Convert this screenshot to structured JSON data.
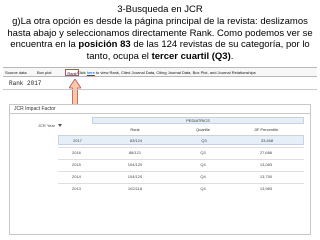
{
  "slide": {
    "title": "3-Busqueda en JCR",
    "text_before": "g)La otra opción es desde la página principal de la revista: deslizamos hasta abajo y seleccionamos directamente Rank. Como podemos ver se encuentra en la ",
    "text_bold_position": "posición 83",
    "text_middle": " de las 124 revistas de su categoría, por lo tanto, ocupa el ",
    "text_bold_quartile": "tercer cuartil (Q3)",
    "text_after": "."
  },
  "navbar": {
    "tabs": [
      "Source data",
      "Box plot",
      "Rank"
    ],
    "active_tab": "Rank",
    "hint_prefix": "Click ",
    "hint_link": "here",
    "hint_suffix": " to view Rank, Cited Journal Data, Citing Journal Data, Box Plot, and Journal Relationships"
  },
  "rank_heading": "Rank 2017",
  "impact_panel": {
    "title": "JCR Impact Factor",
    "year_label": "JCR Year",
    "category": "PEDIATRICS",
    "columns": [
      "Rank",
      "Quartile",
      "JIF Percentile"
    ],
    "rows": [
      {
        "year": "2017",
        "rank": "83/124",
        "quartile": "Q3",
        "percentile": "33,468"
      },
      {
        "year": "2016",
        "rank": "88/121",
        "quartile": "Q3",
        "percentile": "27,686"
      },
      {
        "year": "2015",
        "rank": "104/120",
        "quartile": "Q4",
        "percentile": "13,083"
      },
      {
        "year": "2014",
        "rank": "104/120",
        "quartile": "Q4",
        "percentile": "13,750"
      },
      {
        "year": "2013",
        "rank": "102/118",
        "quartile": "Q4",
        "percentile": "13,983"
      }
    ],
    "highlighted_year": "2017"
  },
  "colors": {
    "highlight_red": "#c0504d",
    "arrow_fill": "#f8c9a8",
    "header_blue": "#e6eef8",
    "link_blue": "#0a56b8"
  },
  "icons": {
    "arrow": "up-arrow-icon",
    "dropdown": "caret-down-icon"
  }
}
